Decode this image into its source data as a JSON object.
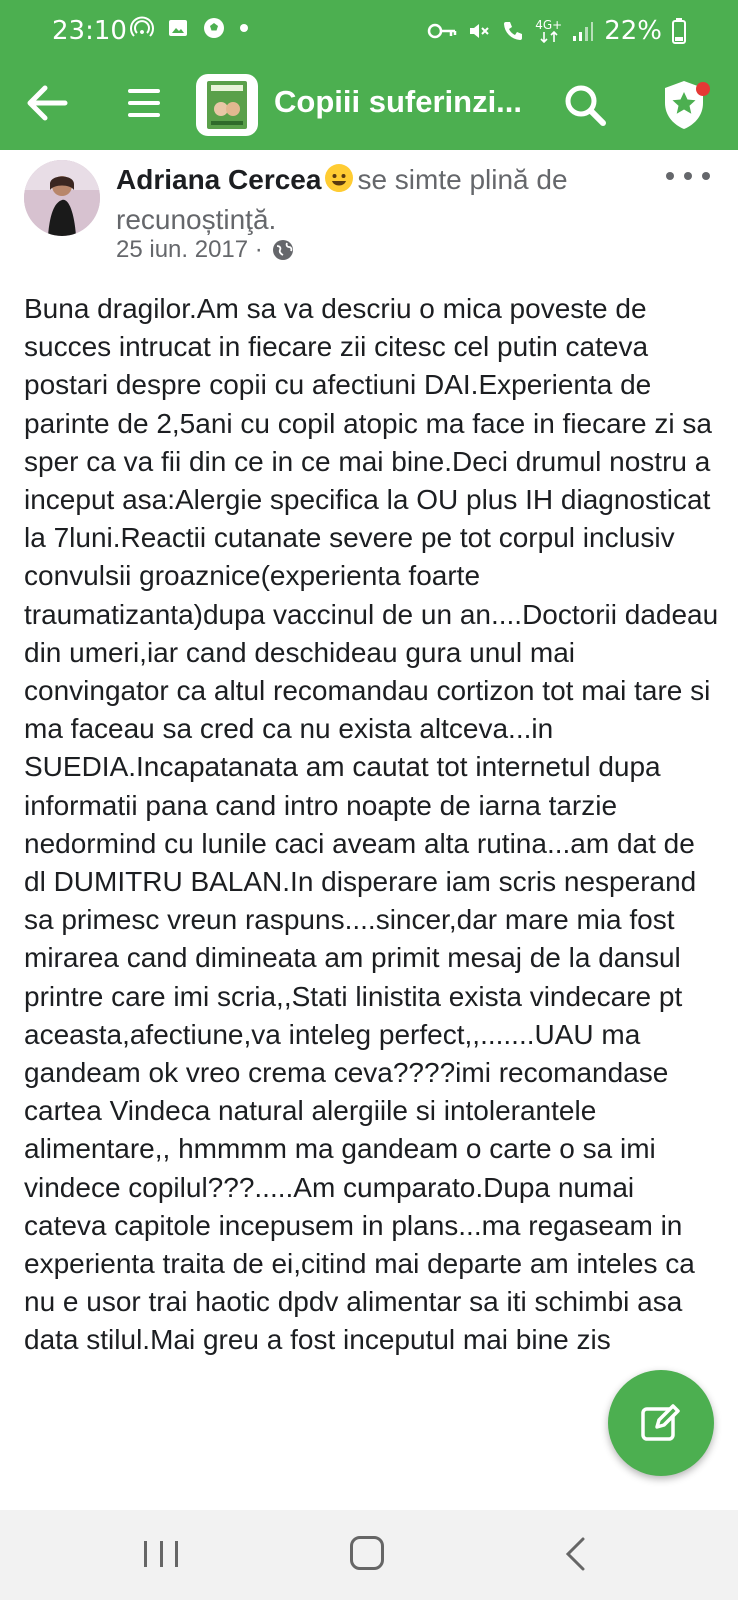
{
  "status": {
    "time": "23:10",
    "network": "4G+",
    "battery": "22%",
    "left_icons": [
      "hotspot-icon",
      "gallery-icon",
      "soccer-icon",
      "dot-icon"
    ],
    "right_icons": [
      "key-icon",
      "mute-icon",
      "call-icon",
      "network-4g-icon",
      "signal-icon",
      "battery-icon"
    ]
  },
  "appbar": {
    "title": "Copiii suferinzi...",
    "color": "#4caf50"
  },
  "post": {
    "author": "Adriana Cercea",
    "feeling": "se simte plină de recunoștinţă.",
    "date": "25 iun. 2017 ·",
    "body": "Buna dragilor.Am sa va descriu o mica poveste de succes intrucat in fiecare zii citesc cel putin cateva postari despre copii cu afectiuni DAI.Experienta de parinte de 2,5ani cu copil atopic ma face in fiecare zi sa sper ca va fii din ce in ce mai bine.Deci drumul nostru a inceput asa:Alergie specifica la OU plus IH diagnosticat la 7luni.Reactii cutanate severe pe tot corpul inclusiv convulsii groaznice(experienta foarte traumatizanta)dupa vaccinul de un an....Doctorii dadeau din umeri,iar cand deschideau gura unul mai convingator ca altul recomandau cortizon tot mai tare si  ma faceau sa cred ca nu exista altceva...in SUEDIA.Incapatanata am cautat tot internetul dupa informatii pana cand intro noapte de iarna tarzie nedormind cu lunile caci aveam alta rutina...am dat de dl DUMITRU BALAN.In disperare iam scris nesperand sa primesc vreun raspuns....sincer,dar mare mia fost mirarea cand dimineata am primit mesaj de la dansul printre care imi scria,,Stati linistita exista vindecare pt aceasta,afectiune,va inteleg perfect,,.......UAU ma gandeam ok vreo crema ceva????imi recomandase cartea Vindeca natural alergiile si intolerantele alimentare,, hmmmm ma gandeam o carte o sa imi vindece copilul???.....Am cumparato.Dupa numai cateva capitole incepusem in plans...ma regaseam in experienta traita de ei,citind mai departe am inteles ca nu e usor trai haotic dpdv alimentar sa iti schimbi asa data stilul.Mai greu a fost inceputul mai bine zis"
  }
}
